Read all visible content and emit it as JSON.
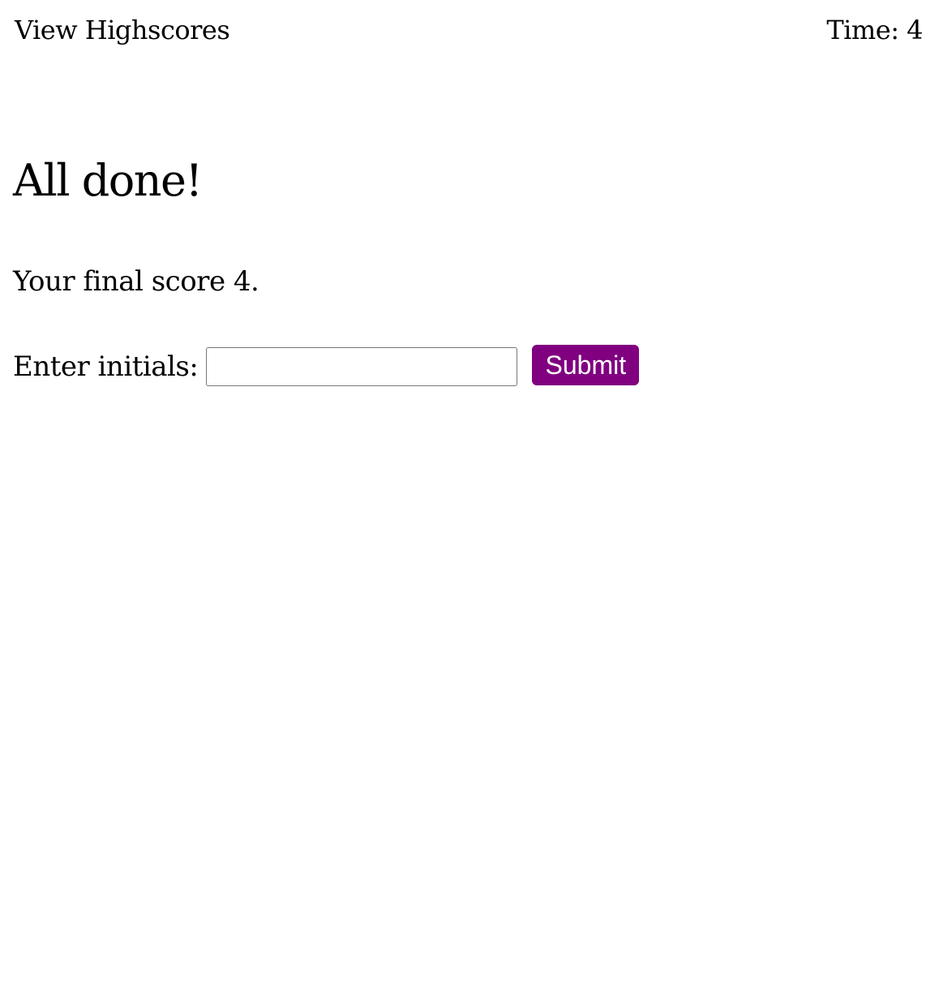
{
  "header": {
    "view_highscores_label": "View Highscores",
    "timer_label": "Time: ",
    "timer_value": "4"
  },
  "main": {
    "heading": "All done!",
    "final_score_prefix": "Your final score ",
    "final_score_value": "4",
    "final_score_suffix": ".",
    "initials_label": "Enter initials:",
    "initials_value": "",
    "initials_placeholder": "",
    "submit_label": "Submit"
  },
  "colors": {
    "submit_background": "#800080",
    "submit_text": "#ffffff",
    "text": "#000000",
    "background": "#ffffff"
  }
}
